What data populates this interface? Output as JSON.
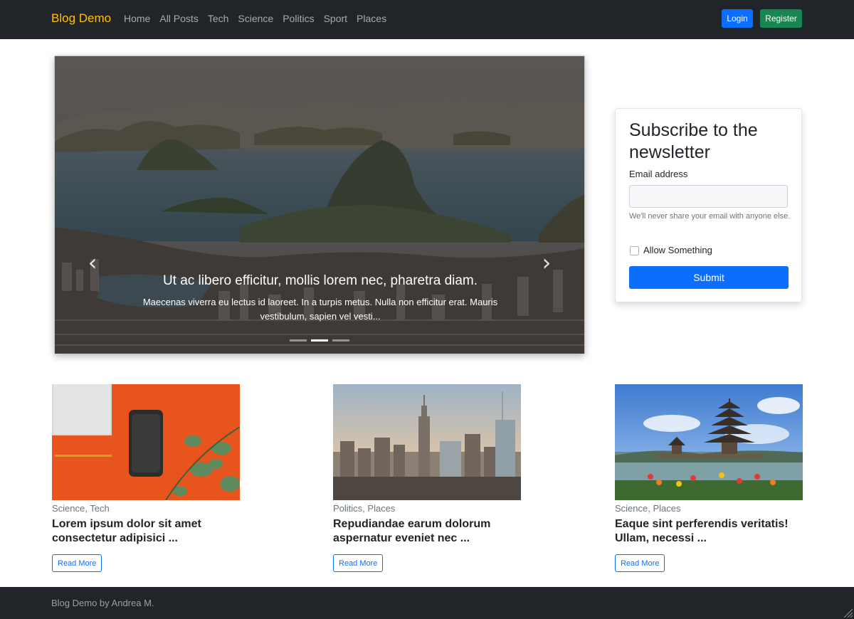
{
  "navbar": {
    "brand": "Blog Demo",
    "links": [
      "Home",
      "All Posts",
      "Tech",
      "Science",
      "Politics",
      "Sport",
      "Places"
    ],
    "login": "Login",
    "register": "Register"
  },
  "carousel": {
    "title": "Ut ac libero efficitur, mollis lorem nec, pharetra diam.",
    "text": "Maecenas viverra eu lectus id laoreet. In a turpis metus. Nulla non efficitur erat. Mauris vestibulum, sapien vel vesti...",
    "prev_icon": "chevron-left-icon",
    "next_icon": "chevron-right-icon",
    "slide_count": 3,
    "active_slide": 2
  },
  "newsletter": {
    "title": "Subscribe to the newsletter",
    "email_label": "Email address",
    "email_value": "",
    "email_help": "We'll never share your email with anyone else.",
    "checkbox_label": "Allow Something",
    "submit": "Submit"
  },
  "posts": [
    {
      "categories": "Science, Tech",
      "title": "Lorem ipsum dolor sit amet consectetur adipisici ...",
      "button": "Read More"
    },
    {
      "categories": "Politics, Places",
      "title": "Repudiandae earum dolorum aspernatur eveniet nec ...",
      "button": "Read More"
    },
    {
      "categories": "Science, Places",
      "title": "Eaque sint perferendis veritatis! Ullam, necessi ...",
      "button": "Read More"
    }
  ],
  "footer": {
    "text": "Blog Demo by Andrea M."
  },
  "colors": {
    "brand": "#ffc107",
    "primary": "#0d6efd",
    "success": "#198754",
    "dark": "#212529"
  }
}
